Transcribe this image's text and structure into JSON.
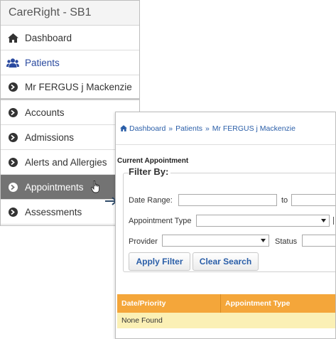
{
  "sidebar": {
    "title": "CareRight - SB1",
    "items": [
      {
        "label": "Dashboard",
        "icon": "home-icon"
      },
      {
        "label": "Patients",
        "icon": "users-icon"
      },
      {
        "label": "Mr FERGUS j Mackenzie",
        "icon": "chevron-circle-right-icon"
      },
      {
        "label": "Accounts",
        "icon": "chevron-circle-right-icon"
      },
      {
        "label": "Admissions",
        "icon": "chevron-circle-right-icon"
      },
      {
        "label": "Alerts and Allergies",
        "icon": "chevron-circle-right-icon"
      },
      {
        "label": "Appointments",
        "icon": "chevron-circle-right-icon"
      },
      {
        "label": "Assessments",
        "icon": "chevron-circle-right-icon"
      }
    ]
  },
  "breadcrumb": {
    "items": [
      "Dashboard",
      "Patients",
      "Mr FERGUS j Mackenzie"
    ],
    "separator": "»"
  },
  "main": {
    "section_title": "Current Appointment",
    "filter_legend": "Filter By:",
    "date_range_label": "Date Range:",
    "to_label": "to",
    "appointment_type_label": "Appointment Type",
    "provider_label": "Provider",
    "status_label": "Status",
    "apply_filter_label": "Apply Filter",
    "clear_search_label": "Clear Search",
    "date_from_value": "",
    "date_to_value": "",
    "appointment_type_value": "",
    "provider_value": "",
    "status_value": "",
    "table": {
      "columns": [
        "Date/Priority",
        "Appointment Type"
      ],
      "empty_message": "None Found"
    }
  },
  "colors": {
    "accent_link": "#2a5ea8",
    "table_header": "#f4a63a",
    "table_row": "#fbf0b5",
    "active_item": "#737373"
  }
}
